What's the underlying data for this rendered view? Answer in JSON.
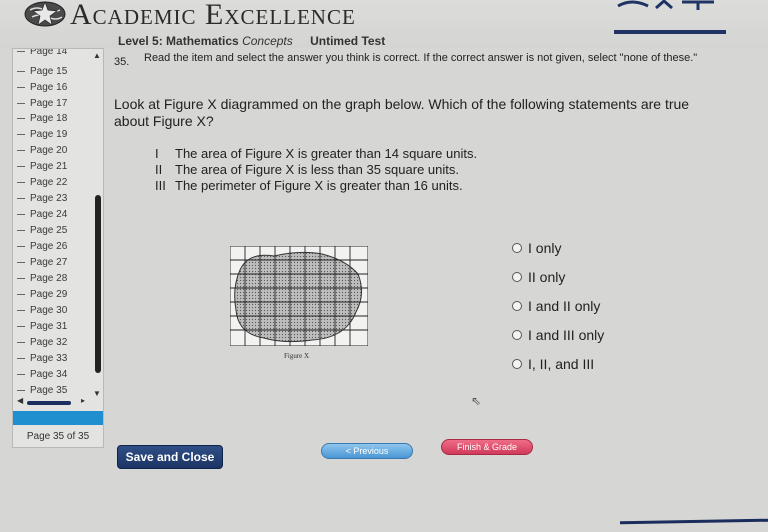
{
  "header": {
    "title": "Academic Excellence",
    "level": "Level 5: Mathematics",
    "subject_tag": "Concepts",
    "test_mode": "Untimed Test"
  },
  "sidebar": {
    "pages": [
      "Page 14",
      "Page 15",
      "Page 16",
      "Page 17",
      "Page 18",
      "Page 19",
      "Page 20",
      "Page 21",
      "Page 22",
      "Page 23",
      "Page 24",
      "Page 25",
      "Page 26",
      "Page 27",
      "Page 28",
      "Page 29",
      "Page 30",
      "Page 31",
      "Page 32",
      "Page 33",
      "Page 34",
      "Page 35"
    ],
    "page_counter": "Page 35 of 35",
    "accent_color": "#1f8fd0"
  },
  "question": {
    "number": "35.",
    "instructions": "Read the item and select the answer you think is correct. If the correct answer is not given, select \"none of these.\"",
    "stem": "Look at Figure X diagrammed on the graph below. Which of the following statements are true about Figure X?",
    "statements": [
      {
        "num": "I",
        "text": "The area of Figure X is greater than 14 square units."
      },
      {
        "num": "II",
        "text": "The area of Figure X is less than 35 square units."
      },
      {
        "num": "III",
        "text": "The perimeter of Figure X is greater than 16 units."
      }
    ],
    "figure_caption": "Figure X",
    "options": [
      "I only",
      "II only",
      "I and II only",
      "I and III only",
      "I, II, and III"
    ]
  },
  "buttons": {
    "save_close": "Save and Close",
    "previous": "< Previous",
    "finish": "Finish & Grade"
  }
}
